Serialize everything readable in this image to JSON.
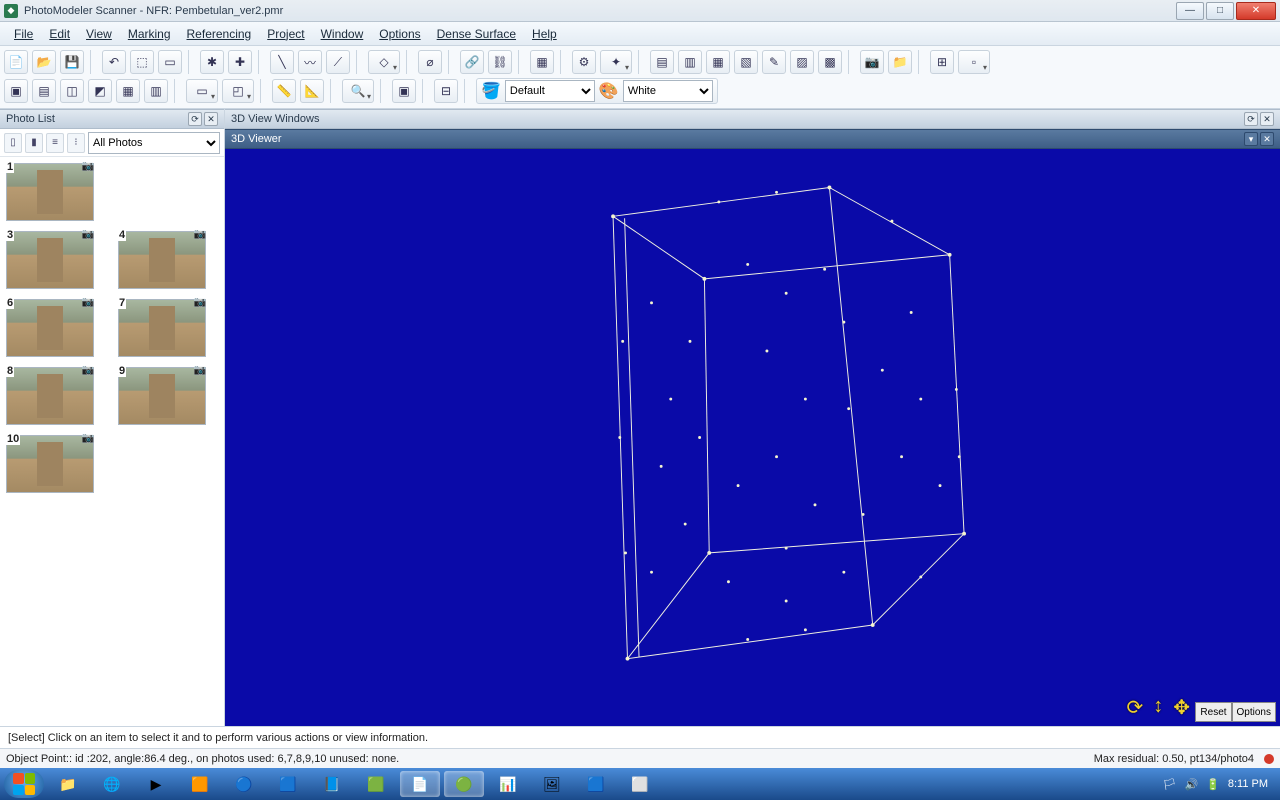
{
  "titlebar": {
    "app": "PhotoModeler Scanner - NFR:",
    "file": "Pembetulan_ver2.pmr"
  },
  "menu": [
    "File",
    "Edit",
    "View",
    "Marking",
    "Referencing",
    "Project",
    "Window",
    "Options",
    "Dense Surface",
    "Help"
  ],
  "toolbar2": {
    "material_label": "Default",
    "color_label": "White"
  },
  "photolist": {
    "title": "Photo List",
    "filter": "All Photos",
    "thumbs": [
      "1",
      "3",
      "4",
      "6",
      "7",
      "8",
      "9",
      "10"
    ]
  },
  "view3d": {
    "windows_title": "3D View Windows",
    "viewer_title": "3D Viewer",
    "reset": "Reset",
    "options": "Options"
  },
  "infobar": "[Select] Click on an item to select it and to perform various actions or view information.",
  "statusbar": {
    "left": "Object Point::  id :202,  angle:86.4 deg.,  on photos used: 6,7,8,9,10   unused: none.",
    "right": "Max residual: 0.50, pt134/photo4"
  },
  "clock": {
    "time": "8:11 PM"
  }
}
